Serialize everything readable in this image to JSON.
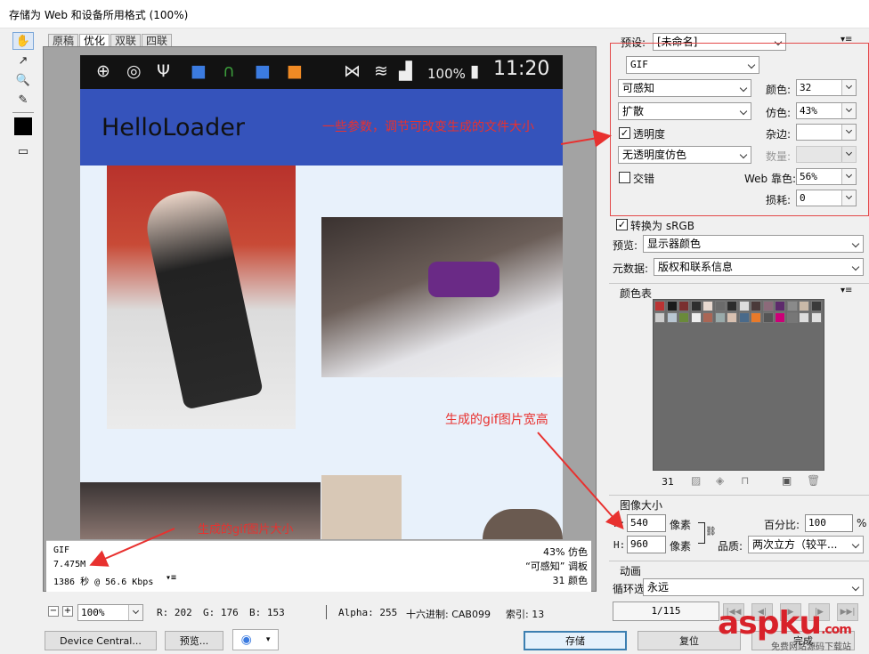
{
  "window": {
    "title": "存储为 Web 和设备所用格式 (100%)"
  },
  "tabs": [
    {
      "label": "原稿"
    },
    {
      "label": "优化"
    },
    {
      "label": "双联"
    },
    {
      "label": "四联"
    }
  ],
  "tools": [
    {
      "icon": "hand-icon"
    },
    {
      "icon": "slice-select-icon"
    },
    {
      "icon": "zoom-icon"
    },
    {
      "icon": "eyedropper-icon"
    },
    {
      "icon": "color-swatch-icon"
    },
    {
      "icon": "toggle-slices-icon"
    }
  ],
  "phone": {
    "battery": "100%",
    "time": "11:20",
    "app_title": "HelloLoader"
  },
  "info": {
    "format": "GIF",
    "size": "7.475M",
    "time": "1386 秒 @ 56.6 Kbps",
    "dither": "43% 仿色",
    "palette": "“可感知” 调板",
    "colors": "31 颜色"
  },
  "statusbar": {
    "zoom": "100%",
    "r": "R: 202",
    "g": "G: 176",
    "b": "B: 153",
    "alpha": "Alpha: 255",
    "hex": "十六进制: CAB099",
    "index": "索引: 13"
  },
  "buttons": {
    "device_central": "Device Central...",
    "preview": "预览...",
    "save": "存储",
    "reset": "复位",
    "done": "完成"
  },
  "settings": {
    "preset_label": "预设:",
    "preset_value": "[未命名]",
    "format": "GIF",
    "reduction": "可感知",
    "colors_label": "颜色:",
    "colors_value": "32",
    "dither_algo": "扩散",
    "dither_label": "仿色:",
    "dither_value": "43%",
    "transparency_label": "透明度",
    "matte_label": "杂边:",
    "trans_dither": "无透明度仿色",
    "amount_label": "数量:",
    "interlaced_label": "交错",
    "web_snap_label": "Web 靠色:",
    "web_snap_value": "56%",
    "lossy_label": "损耗:",
    "lossy_value": "0",
    "convert_srgb": "转换为 sRGB",
    "preview_label": "预览:",
    "preview_value": "显示器颜色",
    "metadata_label": "元数据:",
    "metadata_value": "版权和联系信息"
  },
  "color_table": {
    "title": "颜色表",
    "count": "31",
    "colors": [
      "#b33",
      "#1a1a1a",
      "#7a2f2f",
      "#2e2e2e",
      "#e8d9d0",
      "#6b6b6b",
      "#2c2c2c",
      "#dcdcdc",
      "#4a3a3a",
      "#8c6a7a",
      "#5d2a6c",
      "#8a8a8a",
      "#c9b9a8",
      "#3a3a3a",
      "#ccc",
      "#b9c6d2",
      "#6a8a3a",
      "#eee",
      "#a65",
      "#9aa",
      "#d8c0b0",
      "#4a6a8a",
      "#e87a2a",
      "#555",
      "#c07",
      "#777",
      "#ddd",
      "#e0e0e0"
    ]
  },
  "image_size": {
    "title": "图像大小",
    "w_label": "W:",
    "w_value": "540",
    "w_unit": "像素",
    "h_label": "H:",
    "h_value": "960",
    "h_unit": "像素",
    "percent_label": "百分比:",
    "percent_value": "100",
    "percent_unit": "%",
    "quality_label": "品质:",
    "quality_value": "两次立方（较平..."
  },
  "animation": {
    "title": "动画",
    "loop_label": "循环选项:",
    "loop_value": "永远",
    "frame": "1/115"
  },
  "annotations": {
    "params": "一些参数，调节可改变生成的文件大小",
    "dims": "生成的gif图片宽高",
    "size": "生成的gif图片大小"
  },
  "watermark": {
    "brand": "aspku",
    "suffix": ".com",
    "tagline": "免费网站源码下载站"
  }
}
